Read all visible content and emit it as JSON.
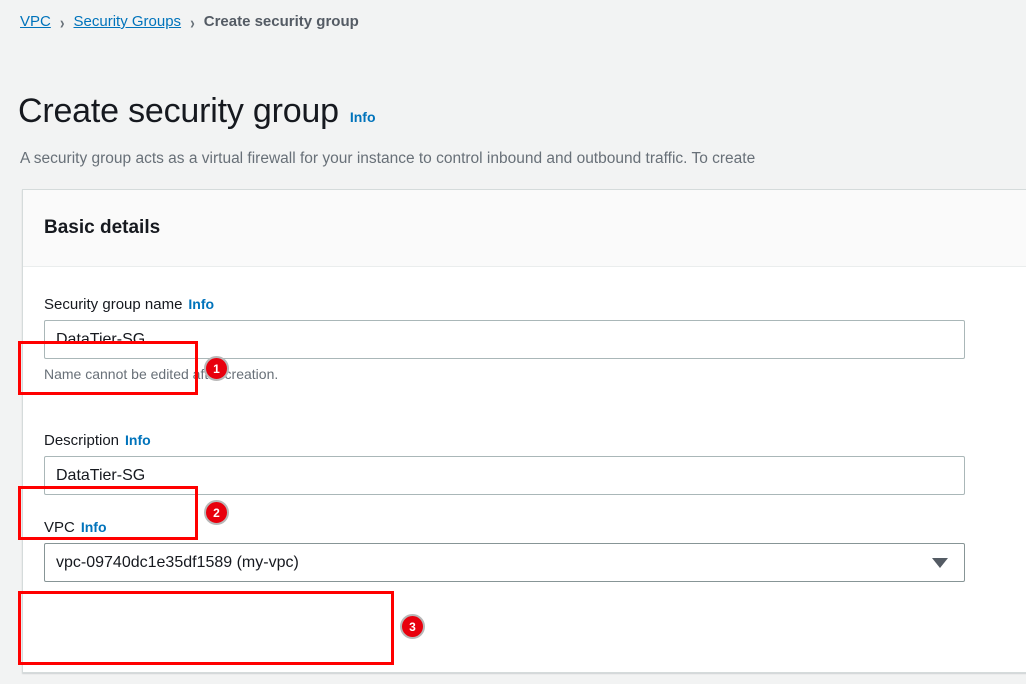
{
  "breadcrumb": {
    "items": [
      {
        "label": "VPC",
        "type": "link"
      },
      {
        "label": "Security Groups",
        "type": "link"
      },
      {
        "label": "Create security group",
        "type": "current"
      }
    ],
    "separator": "›"
  },
  "header": {
    "title": "Create security group",
    "info_label": "Info",
    "description": "A security group acts as a virtual firewall for your instance to control inbound and outbound traffic. To create"
  },
  "panel": {
    "title": "Basic details",
    "fields": {
      "name": {
        "label": "Security group name",
        "info_label": "Info",
        "value": "DataTier-SG",
        "helper": "Name cannot be edited after creation."
      },
      "description": {
        "label": "Description",
        "info_label": "Info",
        "value": "DataTier-SG"
      },
      "vpc": {
        "label": "VPC",
        "info_label": "Info",
        "value": "vpc-09740dc1e35df1589 (my-vpc)",
        "chevron_icon": "chevron-down-icon"
      }
    }
  },
  "annotations": {
    "badges": [
      {
        "number": "1",
        "target": "security-group-name-input"
      },
      {
        "number": "2",
        "target": "description-input"
      },
      {
        "number": "3",
        "target": "vpc-select"
      }
    ],
    "color": "#ff0000"
  }
}
